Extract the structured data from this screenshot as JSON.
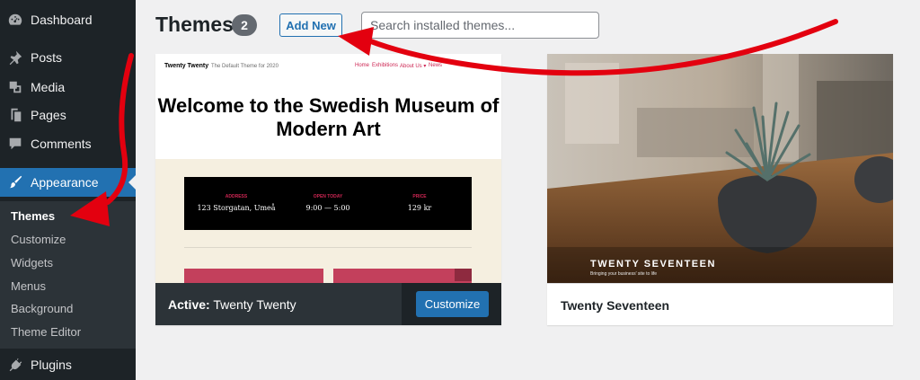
{
  "sidebar": {
    "items": [
      {
        "label": "Dashboard",
        "icon": "dashboard-icon"
      },
      {
        "label": "Posts",
        "icon": "pin-icon"
      },
      {
        "label": "Media",
        "icon": "media-icon"
      },
      {
        "label": "Pages",
        "icon": "pages-icon"
      },
      {
        "label": "Comments",
        "icon": "comment-icon"
      },
      {
        "label": "Appearance",
        "icon": "brush-icon"
      },
      {
        "label": "Plugins",
        "icon": "plugin-icon"
      }
    ],
    "submenu": [
      "Themes",
      "Customize",
      "Widgets",
      "Menus",
      "Background",
      "Theme Editor"
    ],
    "current_sub": "Themes"
  },
  "header": {
    "title": "Themes",
    "count": "2",
    "add_new_label": "Add New",
    "search_placeholder": "Search installed themes..."
  },
  "themes": [
    {
      "name": "Twenty Twenty",
      "active_prefix": "Active:",
      "customize_label": "Customize",
      "preview": {
        "site_name": "Twenty Twenty",
        "tagline": "The Default Theme for 2020",
        "menu": [
          "Home",
          "Exhibitions",
          "About Us ▾",
          "News"
        ],
        "hero": "Welcome to the Swedish Museum of Modern Art",
        "info": [
          {
            "label": "ADDRESS",
            "value": "123 Storgatan, Umeå"
          },
          {
            "label": "OPEN TODAY",
            "value": "9:00 — 5:00"
          },
          {
            "label": "PRICE",
            "value": "129 kr"
          }
        ]
      }
    },
    {
      "name": "Twenty Seventeen",
      "preview": {
        "title": "TWENTY SEVENTEEN",
        "tagline": "Bringing your business' site to life"
      }
    }
  ],
  "colors": {
    "sidebar_bg": "#1d2327",
    "accent": "#2271b1",
    "annotation": "#e3000f"
  }
}
